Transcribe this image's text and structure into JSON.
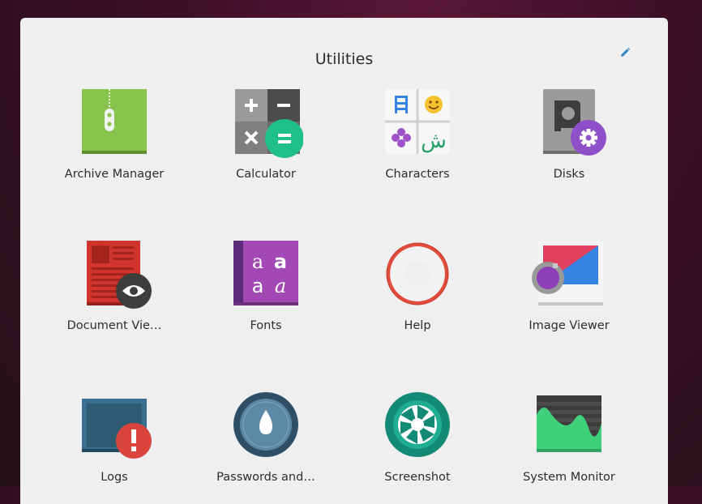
{
  "folder": {
    "title": "Utilities"
  },
  "apps": [
    {
      "label": "Archive Manager"
    },
    {
      "label": "Calculator"
    },
    {
      "label": "Characters"
    },
    {
      "label": "Disks"
    },
    {
      "label": "Document Vie…"
    },
    {
      "label": "Fonts"
    },
    {
      "label": "Help"
    },
    {
      "label": "Image Viewer"
    },
    {
      "label": "Logs"
    },
    {
      "label": "Passwords and…"
    },
    {
      "label": "Screenshot"
    },
    {
      "label": "System Monitor"
    }
  ],
  "characters_icon": {
    "glyph": "ش"
  },
  "fonts_icon": {
    "glyphs": [
      "a",
      "a",
      "a",
      "a"
    ]
  }
}
